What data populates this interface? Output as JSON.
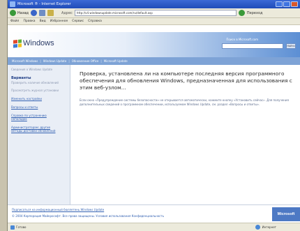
{
  "window": {
    "title": "Microsoft ® - Internet Explorer"
  },
  "toolbar": {
    "back_label": "Назад",
    "address_label": "Адрес",
    "address_value": "http://v4.windowsupdate.microsoft.com/ru/default.asp",
    "go_label": "Переход"
  },
  "menu": {
    "items": [
      "Файл",
      "Правка",
      "Вид",
      "Избранное",
      "Сервис",
      "Справка"
    ]
  },
  "header": {
    "logo_text": "Windows",
    "search_label": "Поиск в Microsoft.com",
    "search_button": "Найти"
  },
  "breadcrumb": {
    "items": [
      "Microsoft Windows",
      "Windows Update",
      "Обновление Office",
      "Microsoft Update"
    ]
  },
  "sidebar": {
    "item1": "Сведения о Windows Update",
    "heading": "Варианты",
    "sub1": "Проверить наличие обновлений",
    "item2": "Просмотреть журнал установки",
    "item3": "Изменить настройки",
    "item4": "Вопросы и ответы",
    "item5": "Справка по устранению неполадок",
    "item6": "Администраторам: другие методы доставки обновлений"
  },
  "main": {
    "text": "Проверка, установлена ли на компьютере последняя версия программного обеспечения для обновления Windows, предназначенная для использования с этим веб-узлом...",
    "fine_print": "Если окно «Предупреждение системы безопасности» не открывается автоматически, нажмите кнопку «Установить сейчас». Для получения дополнительных сведений о программном обеспечении, используемом Windows Update, см. раздел «Вопросы и ответы»."
  },
  "footer": {
    "line1": "Подписаться на информационный бюллетень Windows Update",
    "line2": "© 2004 Корпорация Майкрософт. Все права защищены. Условия использования   Конфиденциальность",
    "ms_badge": "Microsoft"
  },
  "status": {
    "left": "Готово",
    "zone": "Интернет"
  },
  "colors": {
    "accent": "#7ea3d6",
    "link": "#3462b2"
  }
}
